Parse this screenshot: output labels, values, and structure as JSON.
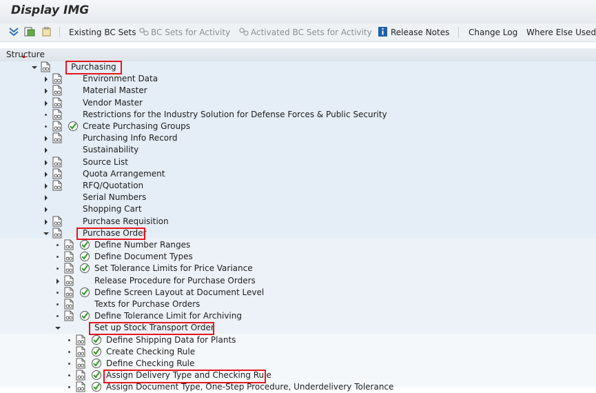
{
  "window": {
    "title": "Display IMG"
  },
  "toolbar": {
    "existing_bc_sets": "Existing BC Sets",
    "bc_sets_activity": "BC Sets for Activity",
    "activated_bc_sets": "Activated BC Sets for Activity",
    "release_notes": "Release Notes",
    "change_log": "Change Log",
    "where_else_used": "Where Else Used"
  },
  "structure": {
    "header": "Structure",
    "rows": [
      {
        "label": "Purchasing"
      },
      {
        "label": "Environment Data"
      },
      {
        "label": "Material Master"
      },
      {
        "label": "Vendor Master"
      },
      {
        "label": "Restrictions for the Industry Solution for Defense Forces & Public Security"
      },
      {
        "label": "Create Purchasing Groups"
      },
      {
        "label": "Purchasing Info Record"
      },
      {
        "label": "Sustainability"
      },
      {
        "label": "Source List"
      },
      {
        "label": "Quota Arrangement"
      },
      {
        "label": "RFQ/Quotation"
      },
      {
        "label": "Serial Numbers"
      },
      {
        "label": "Shopping Cart"
      },
      {
        "label": "Purchase Requisition"
      },
      {
        "label": "Purchase Order"
      },
      {
        "label": "Define Number Ranges"
      },
      {
        "label": "Define Document Types"
      },
      {
        "label": "Set Tolerance Limits for Price Variance"
      },
      {
        "label": "Release Procedure for Purchase Orders"
      },
      {
        "label": "Define Screen Layout at Document Level"
      },
      {
        "label": "Texts for Purchase Orders"
      },
      {
        "label": "Define Tolerance Limit for Archiving"
      },
      {
        "label": "Set up Stock Transport Order"
      },
      {
        "label": "Define Shipping Data for Plants"
      },
      {
        "label": "Create Checking Rule"
      },
      {
        "label": "Define Checking Rule"
      },
      {
        "label": "Assign Delivery Type and Checking Rule"
      },
      {
        "label": "Assign Document Type, One-Step Procedure, Underdelivery Tolerance"
      }
    ]
  }
}
